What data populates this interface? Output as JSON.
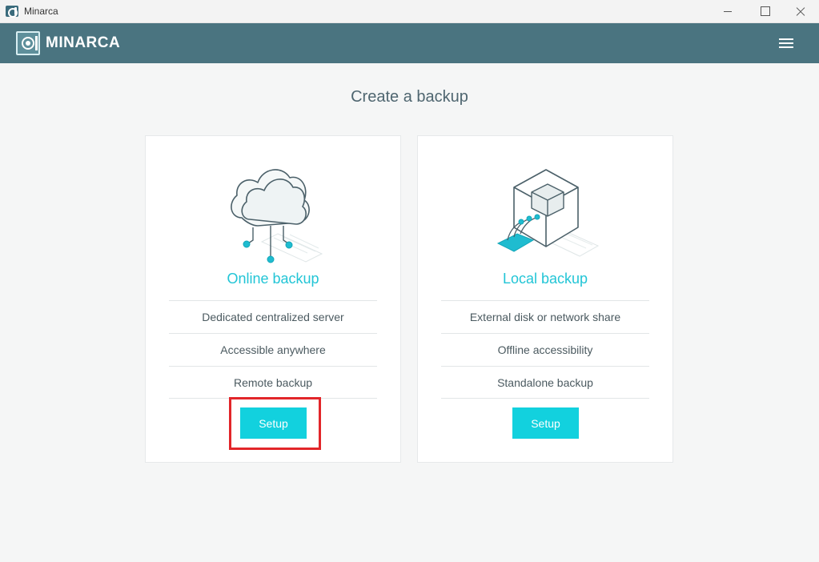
{
  "window": {
    "title": "Minarca"
  },
  "app": {
    "brand": "MINARCA",
    "menu_icon": "hamburger-icon"
  },
  "page": {
    "title": "Create a backup"
  },
  "cards": [
    {
      "title": "Online backup",
      "icon": "cloud-illustration",
      "features": [
        "Dedicated centralized server",
        "Accessible anywhere",
        "Remote backup"
      ],
      "button": "Setup"
    },
    {
      "title": "Local backup",
      "icon": "disk-illustration",
      "features": [
        "External disk or network share",
        "Offline accessibility",
        "Standalone backup"
      ],
      "button": "Setup"
    }
  ],
  "colors": {
    "accent": "#12d1de",
    "header": "#4a7480",
    "highlight": "#e2262a"
  }
}
